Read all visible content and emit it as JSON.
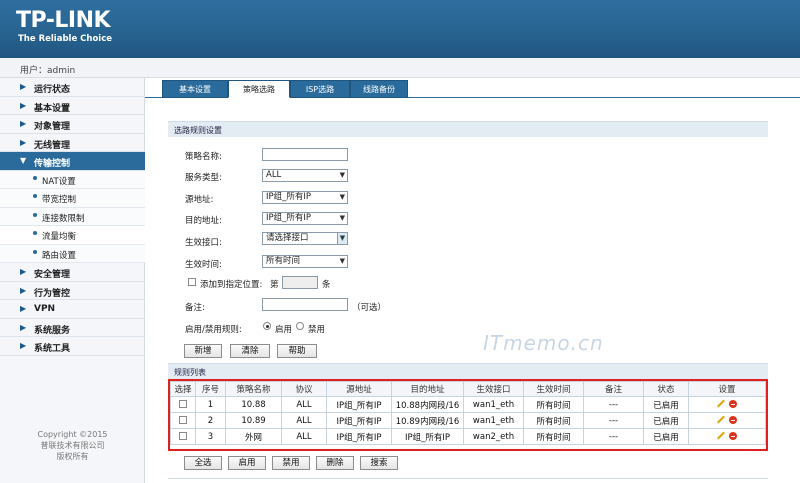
{
  "brand": {
    "logo": "TP-LINK",
    "tagline": "The Reliable Choice"
  },
  "user": {
    "label": "用户：admin"
  },
  "sidebar": {
    "menus": [
      {
        "label": "运行状态"
      },
      {
        "label": "基本设置"
      },
      {
        "label": "对象管理"
      },
      {
        "label": "无线管理"
      },
      {
        "label": "传输控制"
      },
      {
        "label": "安全管理"
      },
      {
        "label": "行为管控"
      },
      {
        "label": "VPN"
      },
      {
        "label": "系统服务"
      },
      {
        "label": "系统工具"
      }
    ],
    "submenus": [
      {
        "label": "NAT设置"
      },
      {
        "label": "带宽控制"
      },
      {
        "label": "连接数限制"
      },
      {
        "label": "流量均衡"
      },
      {
        "label": "路由设置"
      }
    ],
    "copyright": [
      "Copyright ©2015",
      "普联技术有限公司",
      "版权所有"
    ]
  },
  "tabs": [
    {
      "label": "基本设置"
    },
    {
      "label": "策略选路"
    },
    {
      "label": "ISP选路"
    },
    {
      "label": "线路备份"
    }
  ],
  "form": {
    "section_title": "选路规则设置",
    "policy_name_label": "策略名称:",
    "policy_name_value": "",
    "service_type_label": "服务类型:",
    "service_type_value": "ALL",
    "src_label": "源地址:",
    "src_value": "IP组_所有IP",
    "dst_label": "目的地址:",
    "dst_value": "IP组_所有IP",
    "iface_label": "生效接口:",
    "iface_value": "请选择接口",
    "time_label": "生效时间:",
    "time_value": "所有时间",
    "add_position_label": "添加到指定位置:",
    "position_prefix": "第",
    "position_value": "",
    "position_suffix": "条",
    "note_label": "备注:",
    "note_value": "",
    "note_hint": "（可选）",
    "enable_label": "启用/禁用规则:",
    "enable_option": "启用",
    "disable_option": "禁用",
    "btn_add": "新增",
    "btn_clear": "清除",
    "btn_help": "帮助"
  },
  "watermark": "ITmemo.cn",
  "list": {
    "section_title": "规则列表",
    "headers": [
      "选择",
      "序号",
      "策略名称",
      "协议",
      "源地址",
      "目的地址",
      "生效接口",
      "生效时间",
      "备注",
      "状态",
      "设置"
    ],
    "rows": [
      {
        "index": "1",
        "name": "10.88",
        "protocol": "ALL",
        "src": "IP组_所有IP",
        "dst": "10.88内网段/16",
        "iface": "wan1_eth",
        "time": "所有时间",
        "note": "---",
        "status": "已启用"
      },
      {
        "index": "2",
        "name": "10.89",
        "protocol": "ALL",
        "src": "IP组_所有IP",
        "dst": "10.89内网段/16",
        "iface": "wan1_eth",
        "time": "所有时间",
        "note": "---",
        "status": "已启用"
      },
      {
        "index": "3",
        "name": "外网",
        "protocol": "ALL",
        "src": "IP组_所有IP",
        "dst": "IP组_所有IP",
        "iface": "wan2_eth",
        "time": "所有时间",
        "note": "---",
        "status": "已启用"
      }
    ],
    "btn_select_all": "全选",
    "btn_enable": "启用",
    "btn_disable": "禁用",
    "btn_delete": "删除",
    "btn_search": "搜索"
  },
  "colors": {
    "header_blue": "#27628f",
    "highlight_red": "#e02020",
    "active_menu": "#2a6b9c"
  }
}
